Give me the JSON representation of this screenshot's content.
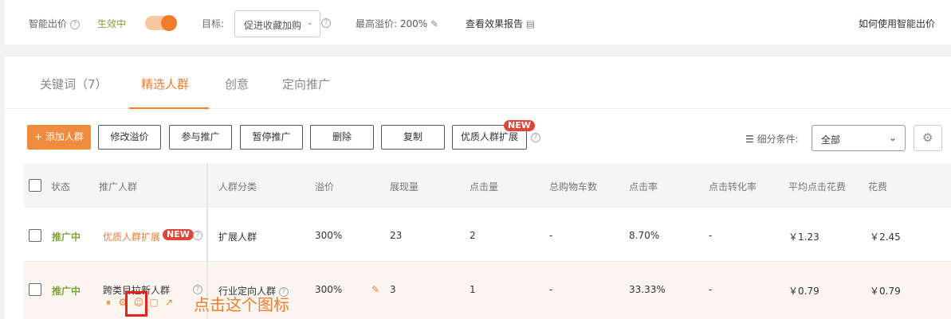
{
  "topbar": {
    "smart_bid_label": "智能出价",
    "status_text": "生效中",
    "goal_label": "目标:",
    "goal_value": "促进收藏加购",
    "max_premium_label": "最高溢价:",
    "max_premium_value": "200%",
    "report_link": "查看效果报告",
    "help_link": "如何使用智能出价"
  },
  "tabs": [
    "关键词（7）",
    "精选人群",
    "创意",
    "定向推广"
  ],
  "toolbar": {
    "add": "+ 添加人群",
    "modify": "修改溢价",
    "join": "参与推广",
    "pause": "暂停推广",
    "delete": "删除",
    "copy": "复制",
    "expand": "优质人群扩展",
    "new_badge": "NEW",
    "filter_label": "细分条件:",
    "filter_value": "全部"
  },
  "table": {
    "headers": [
      "状态",
      "推广人群",
      "人群分类",
      "溢价",
      "展现量",
      "点击量",
      "总购物车数",
      "点击率",
      "点击转化率",
      "平均点击花费",
      "花费"
    ],
    "rows": [
      {
        "status": "推广中",
        "crowd": "优质人群扩展",
        "badge": "NEW",
        "category": "扩展人群",
        "premium": "300%",
        "impressions": "23",
        "clicks": "2",
        "carts": "-",
        "ctr": "8.70%",
        "cvr": "-",
        "avg_cost": "￥1.23",
        "cost": "￥2.45"
      },
      {
        "status": "推广中",
        "crowd": "跨类目拉新人群",
        "category": "行业定向人群",
        "premium": "300%",
        "impressions": "3",
        "clicks": "1",
        "carts": "-",
        "ctr": "33.33%",
        "cvr": "-",
        "avg_cost": "￥0.79",
        "cost": "￥0.79"
      }
    ]
  },
  "annotation": "点击这个图标",
  "colors": {
    "accent": "#f07c2c",
    "status_green": "#7aa534",
    "highlight": "#e8221b",
    "badge_red": "#e0453a"
  }
}
